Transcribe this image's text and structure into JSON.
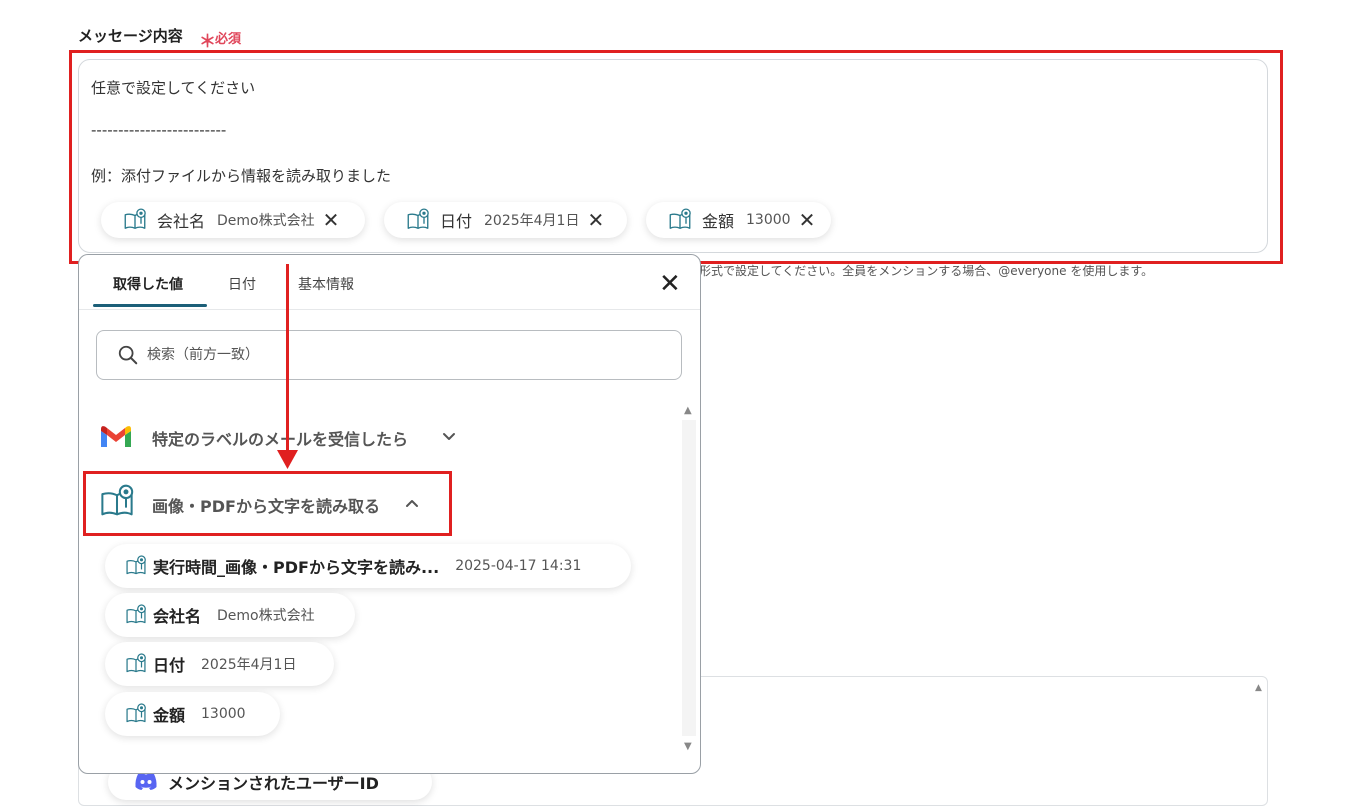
{
  "field": {
    "label": "メッセージ内容",
    "required_star": "＊",
    "required_text": "必須",
    "lines": [
      "任意で設定してください",
      "-------------------------",
      "例：添付ファイルから情報を読み取りました"
    ],
    "chips": [
      {
        "name": "会社名",
        "value": "Demo株式会社"
      },
      {
        "name": "日付",
        "value": "2025年4月1日"
      },
      {
        "name": "金額",
        "value": "13000"
      }
    ],
    "helper_text": "形式で設定してください。全員をメンションする場合、@everyone を使用します。"
  },
  "popup": {
    "tabs": [
      "取得した値",
      "日付",
      "基本情報"
    ],
    "active_tab": "取得した値",
    "search_placeholder": "検索（前方一致）",
    "sections": [
      {
        "title": "特定のラベルのメールを受信したら",
        "icon": "gmail-icon",
        "expanded": false
      },
      {
        "title": "画像・PDFから文字を読み取る",
        "icon": "ocr-book-icon",
        "expanded": true
      }
    ],
    "items": [
      {
        "name": "実行時間_画像・PDFから文字を読み...",
        "value": "2025-04-17 14:31"
      },
      {
        "name": "会社名",
        "value": "Demo株式会社"
      },
      {
        "name": "日付",
        "value": "2025年4月1日"
      },
      {
        "name": "金額",
        "value": "13000"
      }
    ]
  },
  "background": {
    "partial_item_label": "メンションされたユーザーID",
    "partial_item_icon": "discord-icon"
  },
  "colors": {
    "annotation_red": "#e02020",
    "required_red": "#e0465a",
    "tab_underline": "#1c5f78",
    "ocr_icon_teal": "#2a7a8c"
  }
}
